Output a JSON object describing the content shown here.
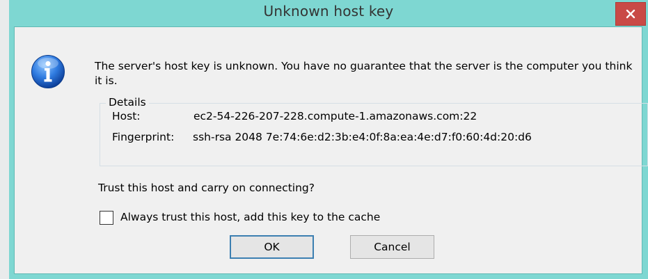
{
  "dialog": {
    "title": "Unknown host key",
    "message": "The server's host key is unknown. You have no guarantee that the server is the computer you think it is.",
    "details": {
      "legend": "Details",
      "host_label": "Host:",
      "host_value": "ec2-54-226-207-228.compute-1.amazonaws.com:22",
      "fingerprint_label": "Fingerprint:",
      "fingerprint_value": "ssh-rsa 2048 7e:74:6e:d2:3b:e4:0f:8a:ea:4e:d7:f0:60:4d:20:d6"
    },
    "question": "Trust this host and carry on connecting?",
    "checkbox": {
      "label": "Always trust this host, add this key to the cache",
      "checked": false
    },
    "buttons": {
      "ok": "OK",
      "cancel": "Cancel"
    },
    "icons": {
      "info": "info-icon",
      "close": "close-icon"
    },
    "colors": {
      "frame": "#7ed7d2",
      "close": "#c94a46",
      "client": "#f0f0f0"
    }
  }
}
